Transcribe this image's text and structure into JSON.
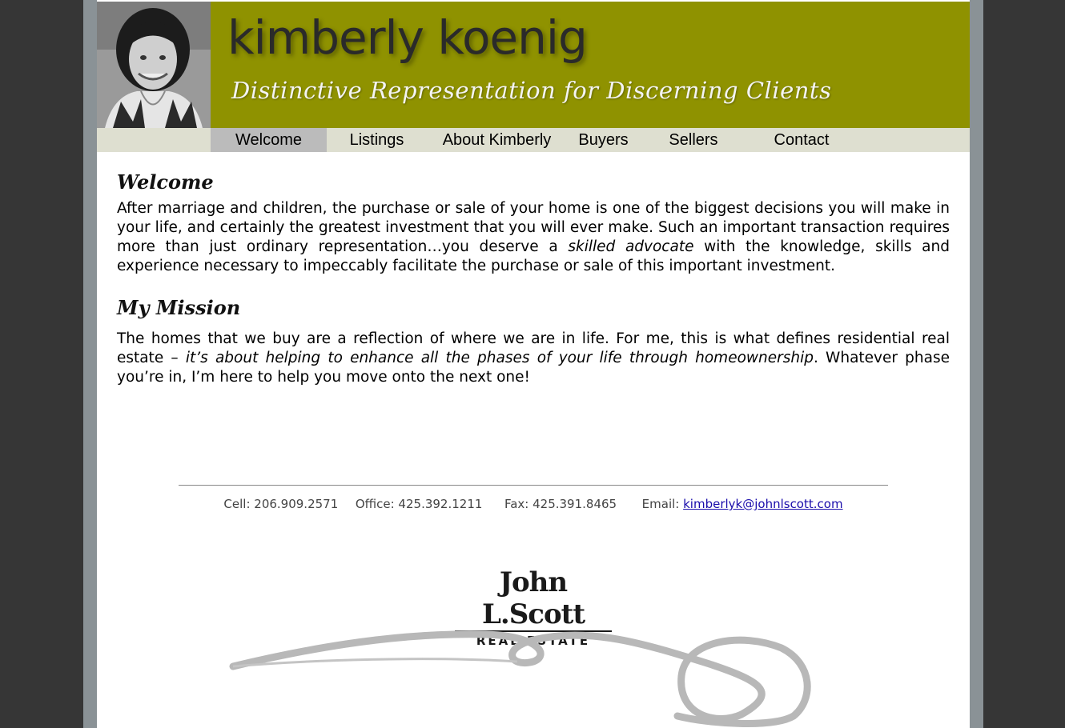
{
  "header": {
    "site_name": "kimberly koenig",
    "tagline": "Distinctive Representation for Discerning Clients"
  },
  "nav": {
    "items": [
      {
        "label": "Welcome"
      },
      {
        "label": "Listings"
      },
      {
        "label": "About Kimberly"
      },
      {
        "label": "Buyers"
      },
      {
        "label": "Sellers"
      },
      {
        "label": "Contact"
      }
    ],
    "active": "Welcome"
  },
  "welcome": {
    "title": "Welcome",
    "text_1": "After marriage and children, the purchase or sale of your home is one of the biggest decisions you will make in your life, and certainly the greatest investment that you will ever make. Such an important transaction requires more than just ordinary representation…you deserve a ",
    "emphasis": "skilled advocate",
    "text_2": " with the knowledge, skills and experience necessary to impeccably facilitate the purchase or sale of this important investment."
  },
  "mission": {
    "title": "My Mission",
    "text_1": "The homes that we buy are a reflection of where we are in life. For me, this is what defines residential real estate – ",
    "emphasis": "it’s about helping to enhance all the phases of your life through homeownership",
    "text_2": ". Whatever phase you’re in, I’m here to help you move onto the next one!"
  },
  "footer": {
    "cell": "Cell: 206.909.2571",
    "office": "Office: 425.392.1211",
    "fax": "Fax: 425.391.8465",
    "email_label": "Email:",
    "email": "kimberlyk@johnlscott.com"
  },
  "logo": {
    "name": "John L.Scott",
    "sub": "REAL ESTATE"
  },
  "colors": {
    "header_bg": "#8f9200",
    "nav_bg": "#dedfd0",
    "nav_active": "#bbbbbb",
    "outer_bg": "#363636",
    "frame": "#8a9296"
  },
  "icons": {
    "portrait": "portrait-photo",
    "swirl": "decorative-swirl"
  }
}
